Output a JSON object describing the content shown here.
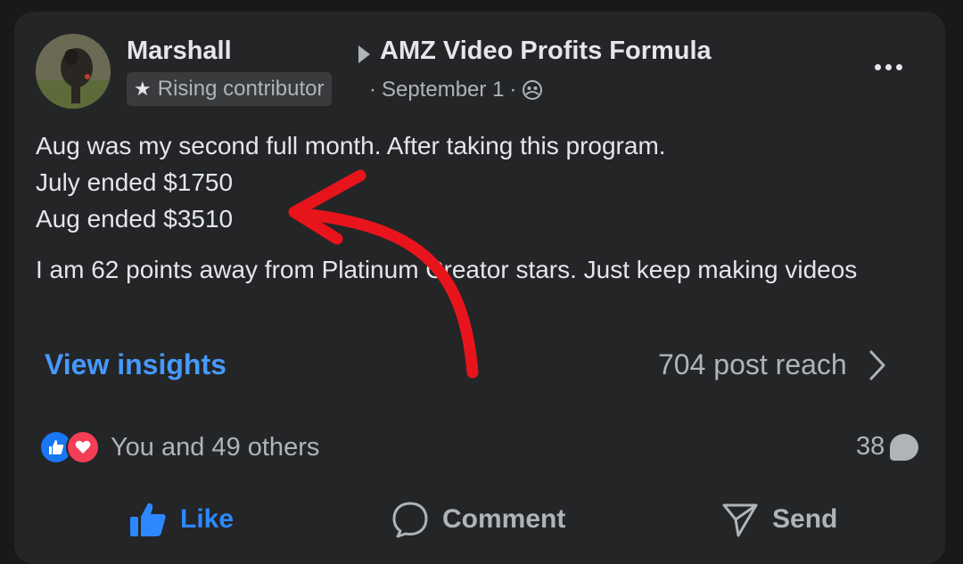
{
  "post": {
    "author": "Marshall",
    "group_name": "AMZ Video Profits Formula",
    "badge_label": "Rising contributor",
    "date": "September 1",
    "separator": "·",
    "text_lines": [
      "Aug was my second full month. After taking this program.",
      "July ended $1750",
      "Aug ended $3510"
    ],
    "text_para2": "I am 62 points away from Platinum Creator stars.  Just keep making videos"
  },
  "insights": {
    "link_label": "View insights",
    "reach_text": "704 post reach"
  },
  "engagement": {
    "reactions_text": "You and 49 others",
    "comments_count": "38"
  },
  "actions": {
    "like_label": "Like",
    "comment_label": "Comment",
    "send_label": "Send"
  },
  "icons": {
    "more": "more-options-icon",
    "badge": "star-icon",
    "audience": "group-audience-icon",
    "chevron": "chevron-right-icon",
    "like_reaction": "like-reaction-icon",
    "love_reaction": "love-reaction-icon",
    "comment_count": "comment-bubble-icon",
    "like_action": "thumbs-up-icon",
    "comment_action": "comment-icon",
    "send_action": "send-icon"
  },
  "colors": {
    "card_bg": "#242526",
    "link_blue": "#4599ff",
    "like_blue": "#1877f2",
    "love_red": "#f33e58",
    "annotation_red": "#e8141c"
  }
}
